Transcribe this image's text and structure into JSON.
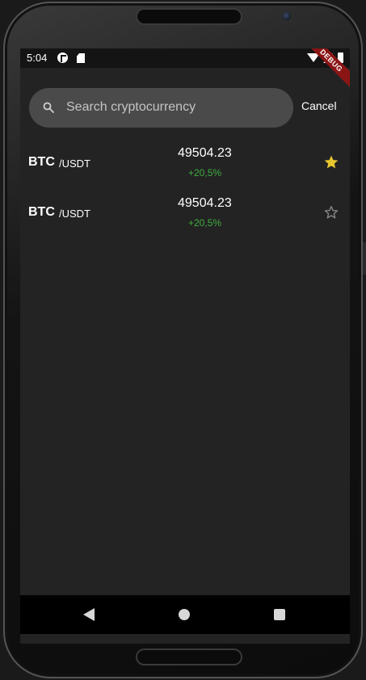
{
  "status_bar": {
    "time": "5:04"
  },
  "debug_banner": "DEBUG",
  "search": {
    "placeholder": "Search cryptocurrency",
    "value": "",
    "cancel_label": "Cancel"
  },
  "rows": [
    {
      "symbol": "BTC",
      "quote": "/USDT",
      "price": "49504.23",
      "change": "+20,5%",
      "favorite": true
    },
    {
      "symbol": "BTC",
      "quote": "/USDT",
      "price": "49504.23",
      "change": "+20,5%",
      "favorite": false
    }
  ],
  "colors": {
    "screen_bg": "#232323",
    "search_bg": "#4a4a4a",
    "positive": "#3fae3f",
    "star_filled": "#e8c72e",
    "star_outline": "#8a8a8a"
  }
}
